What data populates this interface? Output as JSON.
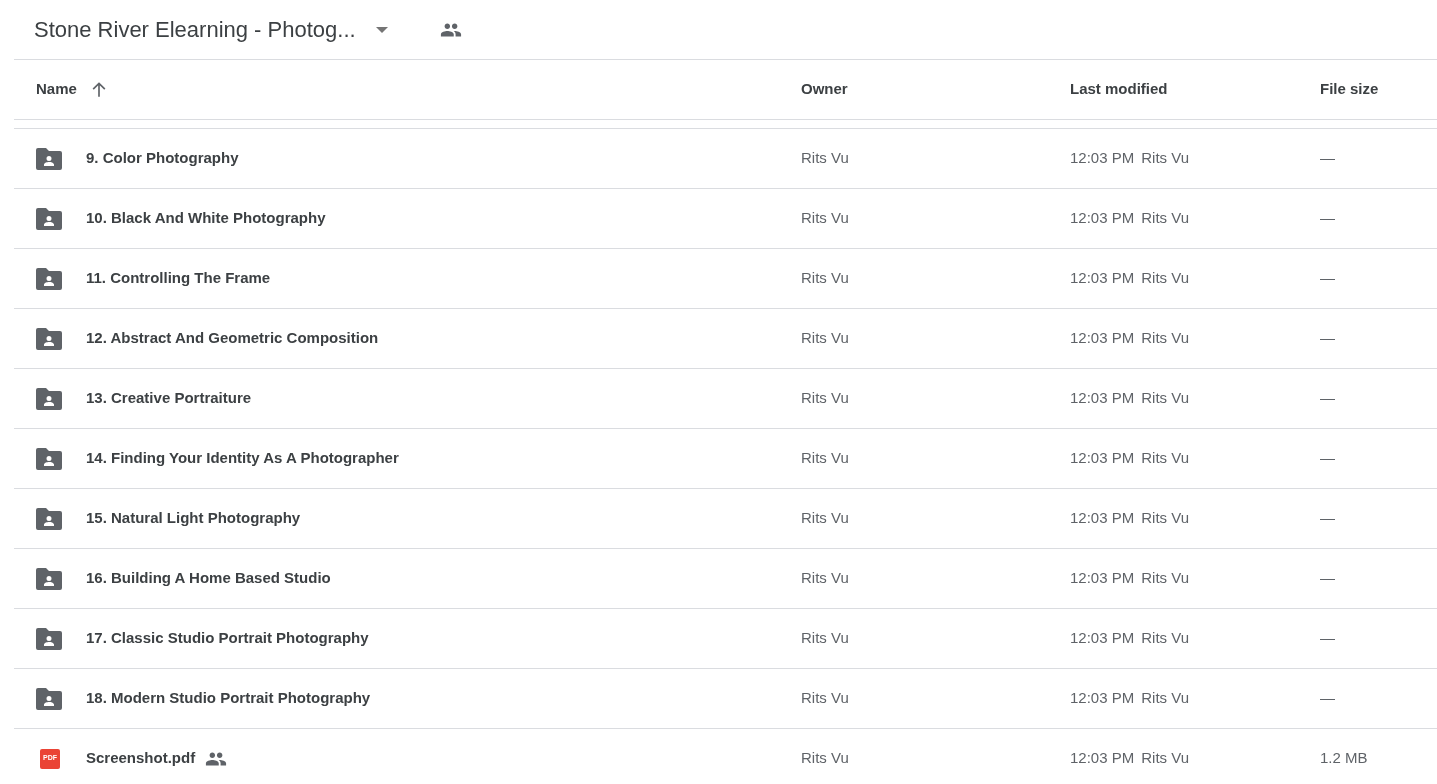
{
  "header": {
    "title": "Stone River Elearning - Photog...",
    "shared": true
  },
  "table": {
    "columns": [
      {
        "label": "Name",
        "sorted": true
      },
      {
        "label": "Owner",
        "sorted": false
      },
      {
        "label": "Last modified",
        "sorted": false
      },
      {
        "label": "File size",
        "sorted": false
      }
    ],
    "rows": [
      {
        "kind": "folder",
        "name": "9. Color Photography",
        "shared": false,
        "owner": "Rits Vu",
        "modified_time": "12:03 PM",
        "modified_by": "Rits Vu",
        "size": "—"
      },
      {
        "kind": "folder",
        "name": "10. Black And White Photography",
        "shared": false,
        "owner": "Rits Vu",
        "modified_time": "12:03 PM",
        "modified_by": "Rits Vu",
        "size": "—"
      },
      {
        "kind": "folder",
        "name": "11. Controlling The Frame",
        "shared": false,
        "owner": "Rits Vu",
        "modified_time": "12:03 PM",
        "modified_by": "Rits Vu",
        "size": "—"
      },
      {
        "kind": "folder",
        "name": "12. Abstract And Geometric Composition",
        "shared": false,
        "owner": "Rits Vu",
        "modified_time": "12:03 PM",
        "modified_by": "Rits Vu",
        "size": "—"
      },
      {
        "kind": "folder",
        "name": "13. Creative Portraiture",
        "shared": false,
        "owner": "Rits Vu",
        "modified_time": "12:03 PM",
        "modified_by": "Rits Vu",
        "size": "—"
      },
      {
        "kind": "folder",
        "name": "14. Finding Your Identity As A Photographer",
        "shared": false,
        "owner": "Rits Vu",
        "modified_time": "12:03 PM",
        "modified_by": "Rits Vu",
        "size": "—"
      },
      {
        "kind": "folder",
        "name": "15. Natural Light Photography",
        "shared": false,
        "owner": "Rits Vu",
        "modified_time": "12:03 PM",
        "modified_by": "Rits Vu",
        "size": "—"
      },
      {
        "kind": "folder",
        "name": "16. Building A Home Based Studio",
        "shared": false,
        "owner": "Rits Vu",
        "modified_time": "12:03 PM",
        "modified_by": "Rits Vu",
        "size": "—"
      },
      {
        "kind": "folder",
        "name": "17. Classic Studio Portrait Photography",
        "shared": false,
        "owner": "Rits Vu",
        "modified_time": "12:03 PM",
        "modified_by": "Rits Vu",
        "size": "—"
      },
      {
        "kind": "folder",
        "name": "18. Modern Studio Portrait Photography",
        "shared": false,
        "owner": "Rits Vu",
        "modified_time": "12:03 PM",
        "modified_by": "Rits Vu",
        "size": "—"
      },
      {
        "kind": "pdf",
        "icon_text": "PDF",
        "name": "Screenshot.pdf",
        "shared": true,
        "owner": "Rits Vu",
        "modified_time": "12:03 PM",
        "modified_by": "Rits Vu",
        "size": "1.2 MB"
      }
    ]
  }
}
